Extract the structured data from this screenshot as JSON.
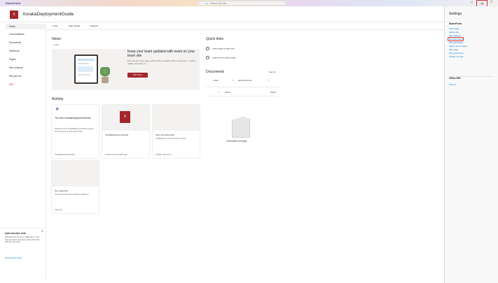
{
  "topbar": {
    "brand": "SharePoint",
    "search_placeholder": "Search this site",
    "icons": [
      "chat-icon",
      "gear-icon",
      "help-icon"
    ]
  },
  "site": {
    "logo_letter": "X",
    "title": "XoraliaDeploymentGuide"
  },
  "leftnav": {
    "items": [
      "Home",
      "Conversations",
      "Documents",
      "Notebook",
      "Pages",
      "Site contents",
      "Recycle bin",
      "Edit"
    ],
    "promo": {
      "title": "Add real-time chat",
      "body": "Add Microsoft Teams to collaborate in real-time and share resources across Microsoft 365 with your team.",
      "link": "Add Microsoft Teams"
    }
  },
  "commandbar": {
    "new": "+ New",
    "page_details": "Page details",
    "analytics": "Analytics"
  },
  "news": {
    "heading": "News",
    "add": "+ Add",
    "hero_title": "Keep your team updated with news on your team site",
    "hero_body": "From the site home page you'll be able to quickly author a news post - a status update, trip report, or...",
    "add_news_button": "Add News"
  },
  "activity": {
    "heading": "Activity",
    "cards": [
      {
        "title": "The new XoraliaDeploymentGuide",
        "body": "Welcome to the XoraliaDeploymentGuide group. Use the group to share ideas, files...",
        "footer": "XoraliaDeploymentGuide"
      },
      {
        "title": "XoraliaDeploymentGuide",
        "footer": "Created a few seconds ago"
      },
      {
        "title": "View and share files",
        "body": "Collaborate on content with your team",
        "footer": "Upload a document"
      },
      {
        "title": "Get organized",
        "body": "Use lists to keep team activities organized",
        "footer": "Add a list"
      }
    ]
  },
  "quicklinks": {
    "heading": "Quick links",
    "items": [
      "Learn about a team site",
      "Learn how to add a page"
    ]
  },
  "documents": {
    "heading": "Documents",
    "see_all": "See all",
    "new": "+ New",
    "view": "All Documents",
    "col_name": "Name",
    "col_modified": "Modif",
    "empty": "This folder is empty"
  },
  "settings": {
    "title": "Settings",
    "sharepoint_heading": "SharePoint",
    "links": [
      "Add a page",
      "Add an app",
      "Site contents",
      "Site information",
      "Site permissions",
      "Apply a site template",
      "Site usage",
      "Site performance",
      "Change the look"
    ],
    "office_heading": "Office 365",
    "office_link": "View all"
  }
}
